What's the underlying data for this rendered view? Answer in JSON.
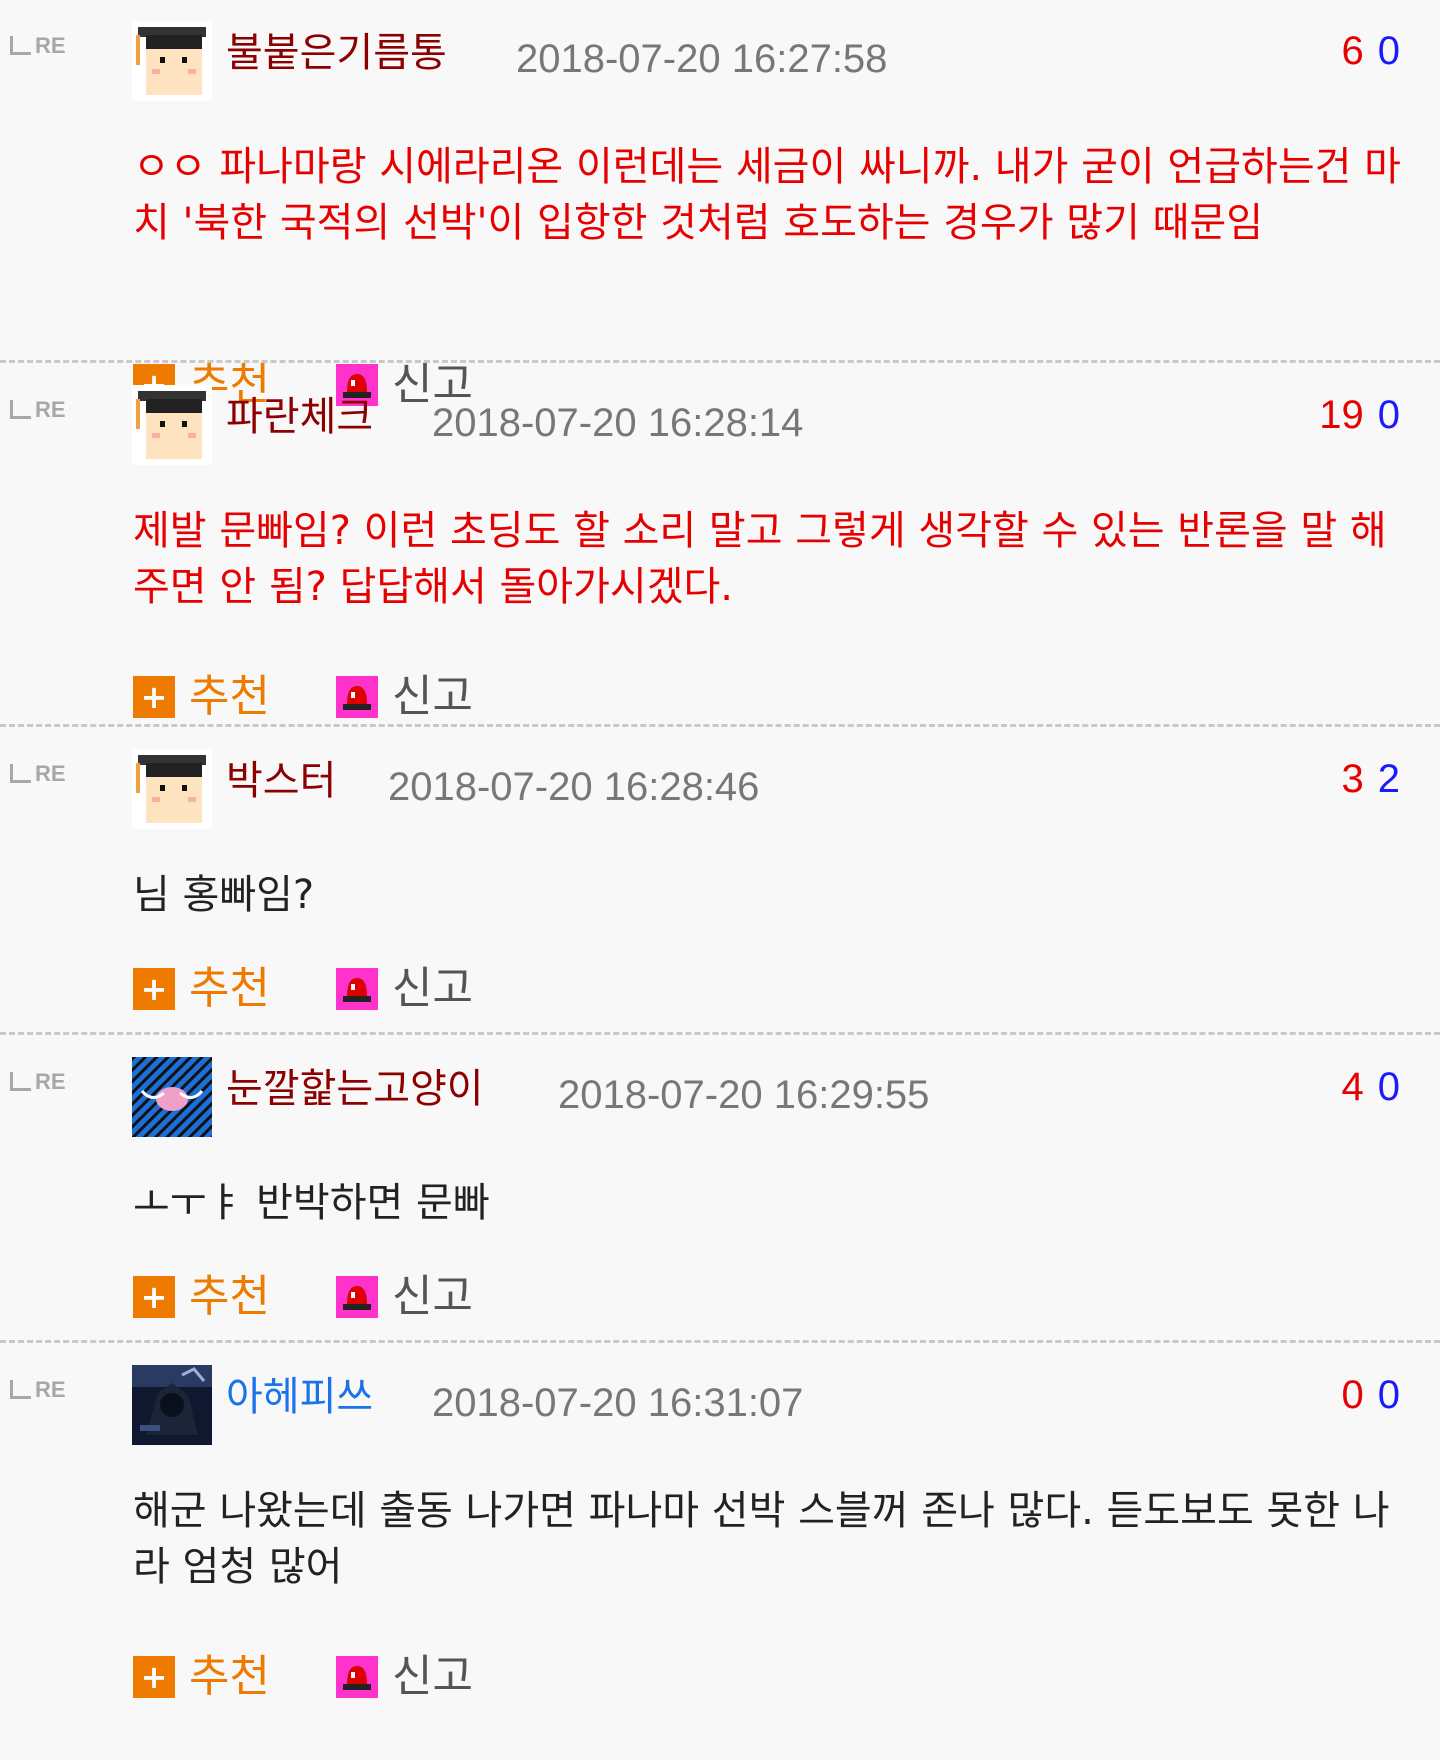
{
  "colors": {
    "nick_default": "#8b0000",
    "nick_blue": "#1a73e8",
    "body_red": "#e60000",
    "body_default": "#222222"
  },
  "icons": {
    "re": "reply-arrow-icon",
    "recommend": "plus-icon",
    "report": "siren-icon"
  },
  "re_label": "RE",
  "recommend_label": "추천",
  "report_label": "신고",
  "comments": [
    {
      "nick": "불붙은기름통",
      "time": "2018-07-20 16:27:58",
      "up": "6",
      "down": "0",
      "body": "ㅇㅇ 파나마랑 시에라리온 이런데는 세금이 싸니까. 내가 굳이 언급하는건 마치 '북한 국적의 선박'이 입항한 것처럼 호도하는 경우가 많기 때문임"
    },
    {
      "nick": "파란체크",
      "time": "2018-07-20 16:28:14",
      "up": "19",
      "down": "0",
      "body": "제발 문빠임? 이런 초딩도 할 소리 말고 그렇게 생각할 수 있는 반론을 말 해주면 안 됨? 답답해서 돌아가시겠다."
    },
    {
      "nick": "박스터",
      "time": "2018-07-20 16:28:46",
      "up": "3",
      "down": "2",
      "body": "님 홍빠임?"
    },
    {
      "nick": "눈깔핥는고양이",
      "time": "2018-07-20 16:29:55",
      "up": "4",
      "down": "0",
      "body": "ㅗㅜㅑ 반박하면 문빠"
    },
    {
      "nick": "아헤피쓰",
      "time": "2018-07-20 16:31:07",
      "up": "0",
      "down": "0",
      "body": "해군 나왔는데 출동 나가면 파나마 선박 스블꺼 존나 많다. 듣도보도 못한 나라 엄청 많어"
    }
  ]
}
